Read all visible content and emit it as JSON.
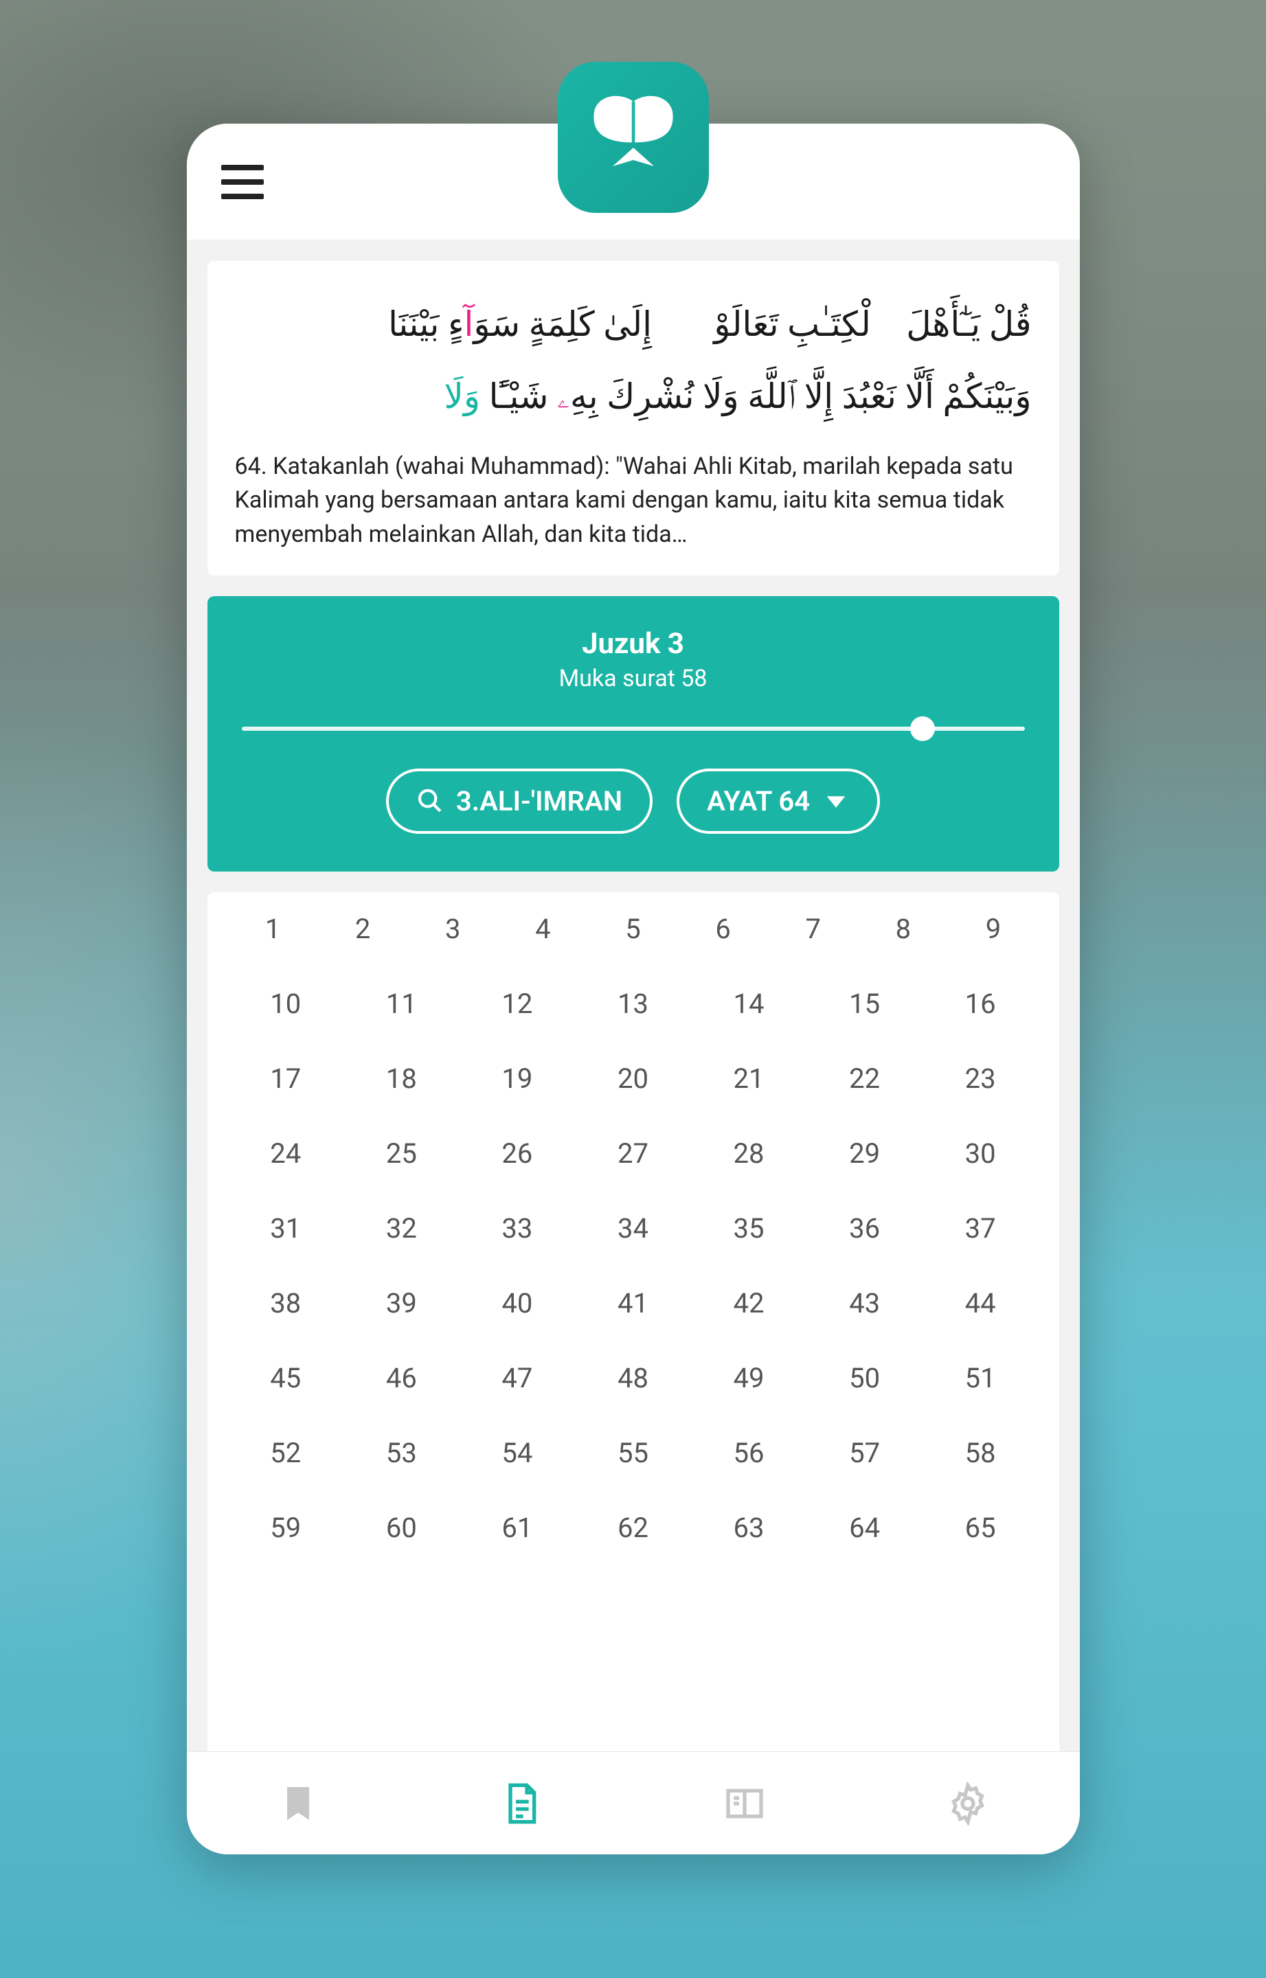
{
  "colors": {
    "accent": "#1ab5a5",
    "pink": "#e91e8c"
  },
  "verse": {
    "arabic_line1_pre": "قُلْ يَـٰٓأَهْلَ ٱلْكِتَـٰبِ تَعَالَوْا۟ إِلَىٰ كَلِمَةٍ سَوَ",
    "arabic_line1_hl": "آ",
    "arabic_line1_post": "ءٍ بَيْنَنَا",
    "arabic_line2_pre": "وَبَيْنَكُمْ أَلَّا نَعْبُدَ إِلَّا ٱللَّهَ وَلَا نُشْرِكَ بِهِ",
    "arabic_line2_hl": "ۦ",
    "arabic_line2_post_a": " شَيْـًٔا ",
    "arabic_line2_tail": "وَلَا",
    "translation": "64. Katakanlah (wahai Muhammad): \"Wahai Ahli Kitab, marilah kepada satu Kalimah yang bersamaan antara kami dengan kamu, iaitu kita semua tidak menyembah melainkan Allah, dan kita tida…"
  },
  "nav": {
    "juzuk_label": "Juzuk 3",
    "page_label": "Muka surat 58",
    "slider_percent": 87,
    "surah_pill": "3.ALI-'IMRAN",
    "ayat_pill": "AYAT 64"
  },
  "grid": {
    "row1": [
      "1",
      "2",
      "3",
      "4",
      "5",
      "6",
      "7",
      "8",
      "9"
    ],
    "rows7": [
      [
        "10",
        "11",
        "12",
        "13",
        "14",
        "15",
        "16"
      ],
      [
        "17",
        "18",
        "19",
        "20",
        "21",
        "22",
        "23"
      ],
      [
        "24",
        "25",
        "26",
        "27",
        "28",
        "29",
        "30"
      ],
      [
        "31",
        "32",
        "33",
        "34",
        "35",
        "36",
        "37"
      ],
      [
        "38",
        "39",
        "40",
        "41",
        "42",
        "43",
        "44"
      ],
      [
        "45",
        "46",
        "47",
        "48",
        "49",
        "50",
        "51"
      ],
      [
        "52",
        "53",
        "54",
        "55",
        "56",
        "57",
        "58"
      ],
      [
        "59",
        "60",
        "61",
        "62",
        "63",
        "64",
        "65"
      ]
    ]
  },
  "bottomnav": {
    "active_index": 1,
    "tabs": [
      "bookmark",
      "page",
      "book",
      "settings"
    ]
  }
}
